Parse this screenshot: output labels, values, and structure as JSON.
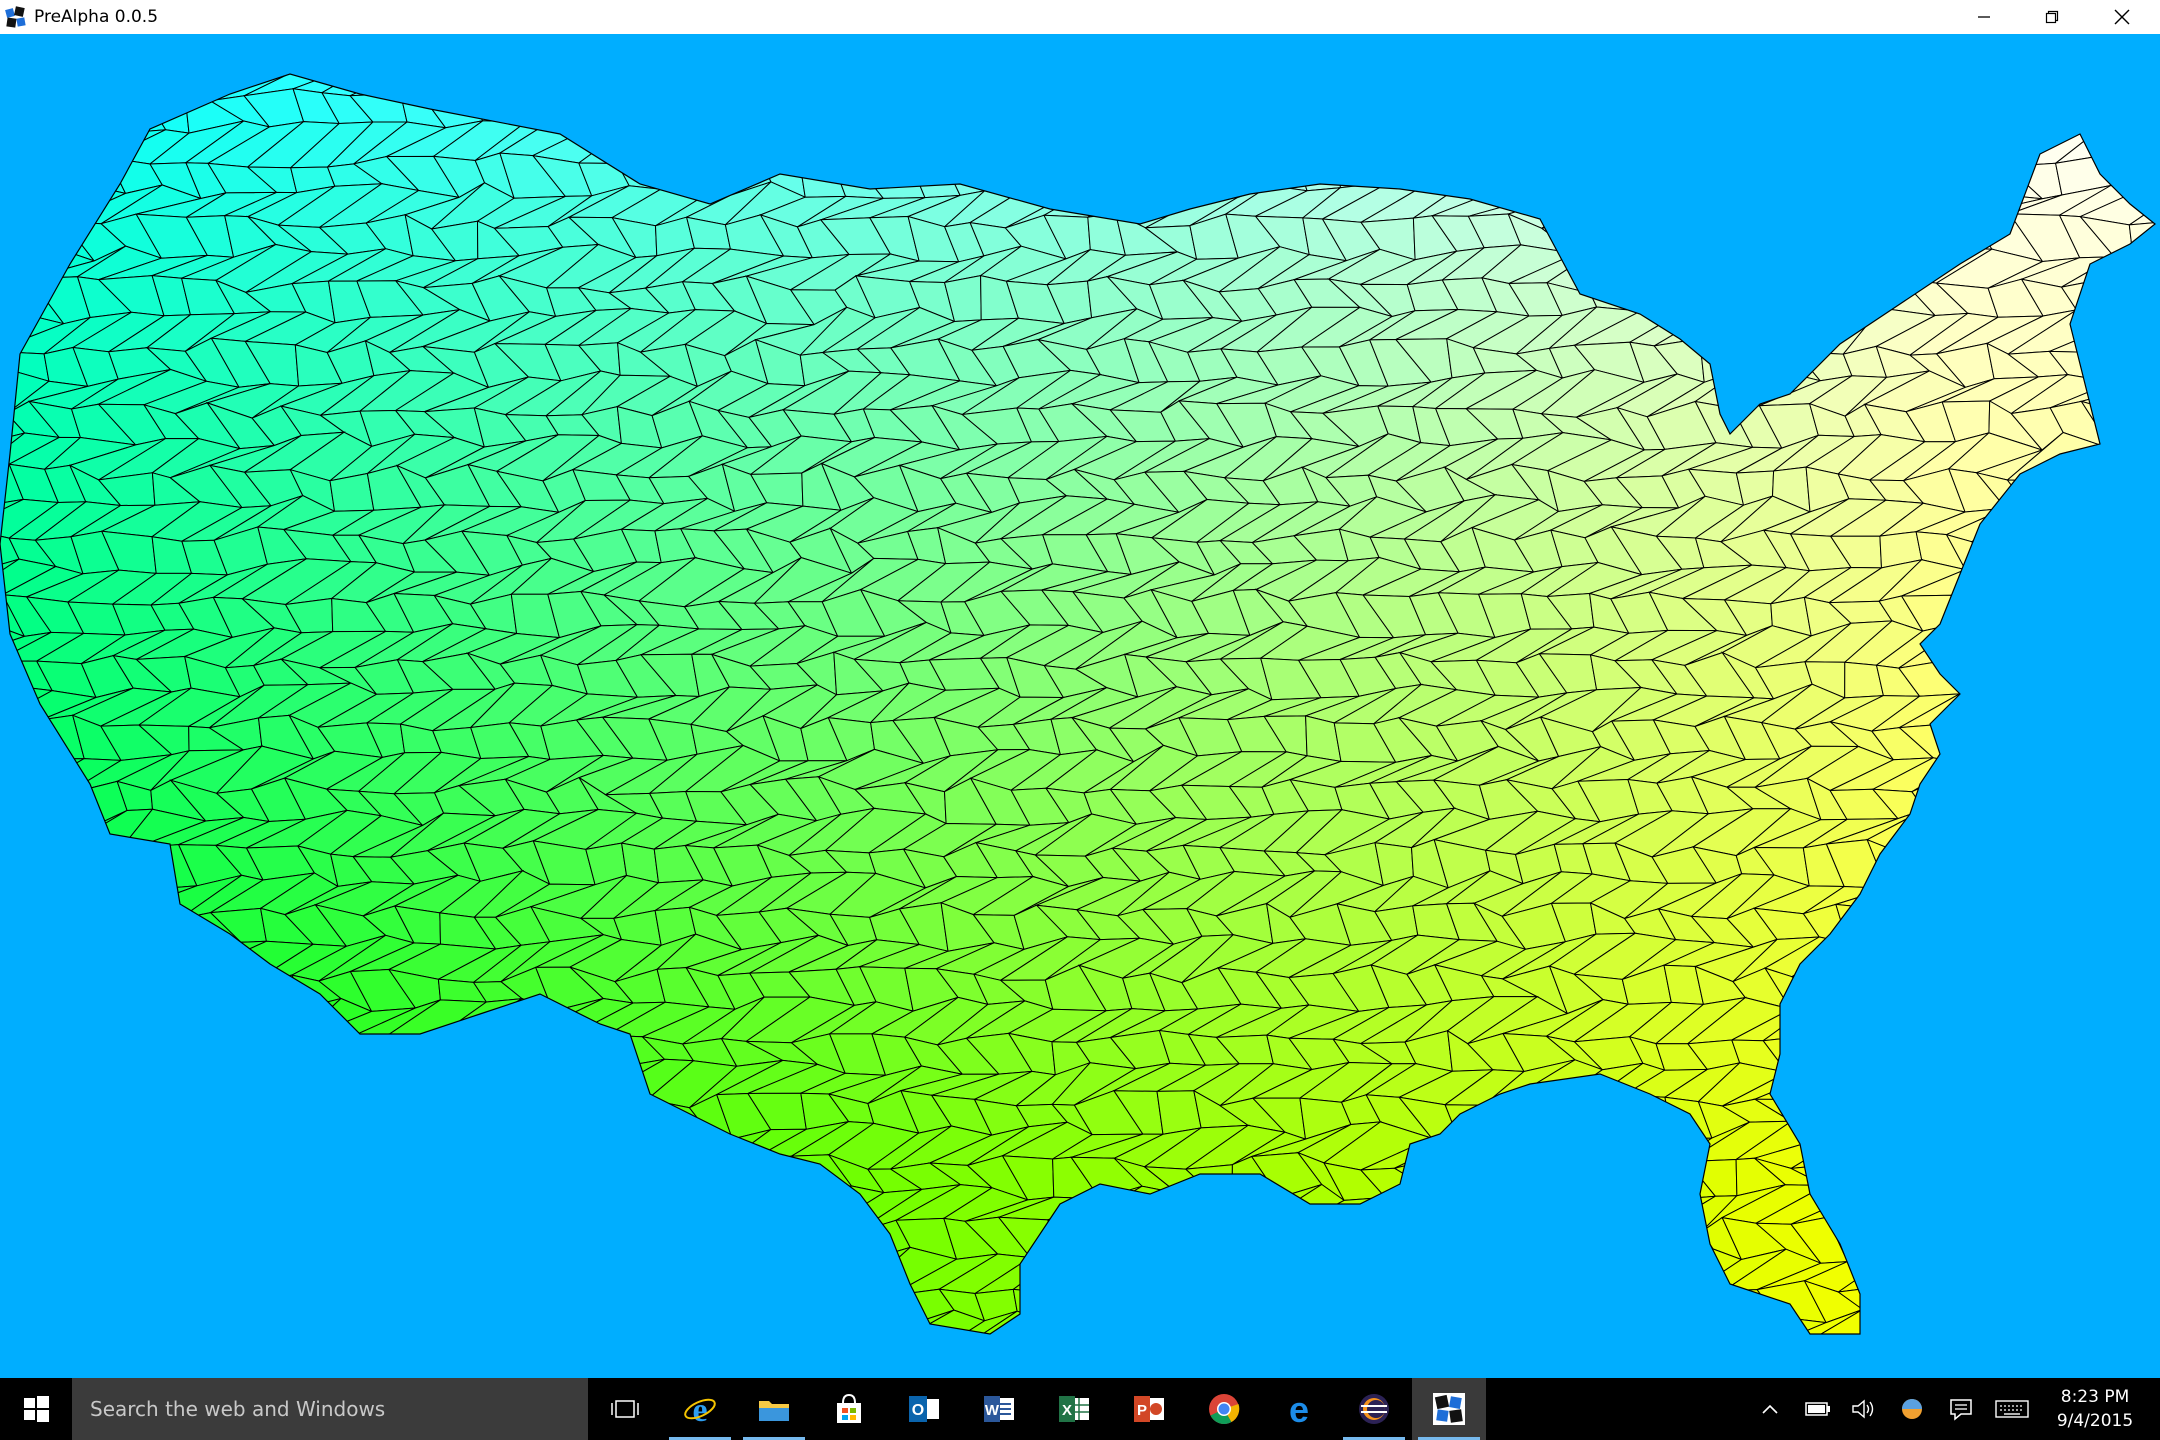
{
  "window": {
    "title": "PreAlpha 0.0.5"
  },
  "map": {
    "background_color": "#00aeff",
    "gradient_colors": {
      "northwest": "#00ffff",
      "southwest": "#00ff00",
      "northeast": "#ffffff",
      "southeast": "#ffff00"
    },
    "cell_stroke_color": "#000000"
  },
  "taskbar": {
    "search_placeholder": "Search the web and Windows",
    "apps": [
      {
        "name": "task-view"
      },
      {
        "name": "internet-explorer"
      },
      {
        "name": "file-explorer"
      },
      {
        "name": "store"
      },
      {
        "name": "outlook"
      },
      {
        "name": "word"
      },
      {
        "name": "excel"
      },
      {
        "name": "powerpoint"
      },
      {
        "name": "chrome"
      },
      {
        "name": "edge"
      },
      {
        "name": "eclipse"
      },
      {
        "name": "prealpha"
      }
    ],
    "clock": {
      "time": "8:23 PM",
      "date": "9/4/2015"
    }
  }
}
